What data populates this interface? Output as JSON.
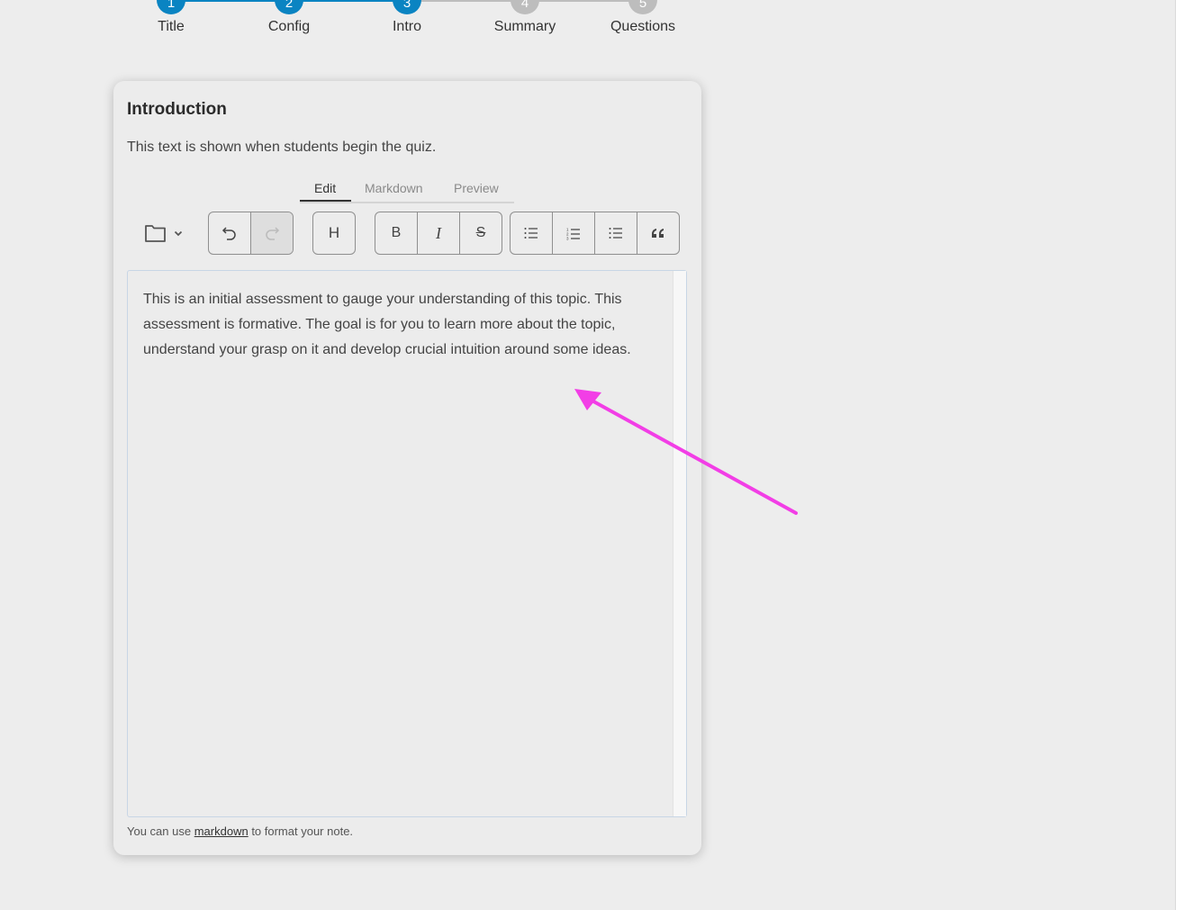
{
  "stepper": {
    "steps": [
      {
        "number": "1",
        "label": "Title",
        "status": "completed"
      },
      {
        "number": "2",
        "label": "Config",
        "status": "completed"
      },
      {
        "number": "3",
        "label": "Intro",
        "status": "active"
      },
      {
        "number": "4",
        "label": "Summary",
        "status": "pending"
      },
      {
        "number": "5",
        "label": "Questions",
        "status": "pending"
      }
    ],
    "colors": {
      "completed": "#0a84c2",
      "pending": "#bdbdbd"
    }
  },
  "card": {
    "title": "Introduction",
    "description": "This text is shown when students begin the quiz."
  },
  "editor": {
    "tabs": [
      {
        "label": "Edit",
        "active": true
      },
      {
        "label": "Markdown",
        "active": false
      },
      {
        "label": "Preview",
        "active": false
      }
    ],
    "toolbar": {
      "folder_icon": "folder-icon",
      "heading_label": "H",
      "bold_label": "B",
      "italic_label": "I",
      "strike_label": "S"
    },
    "content": "This is an initial assessment to gauge your understanding of this topic. This assessment is formative. The goal is for you to learn more about the topic, understand your grasp on it and develop crucial intuition around some ideas."
  },
  "footnote": {
    "prefix": "You can use",
    "link": "markdown",
    "suffix": "to format your note."
  },
  "annotation": {
    "color": "#f23ee6"
  }
}
